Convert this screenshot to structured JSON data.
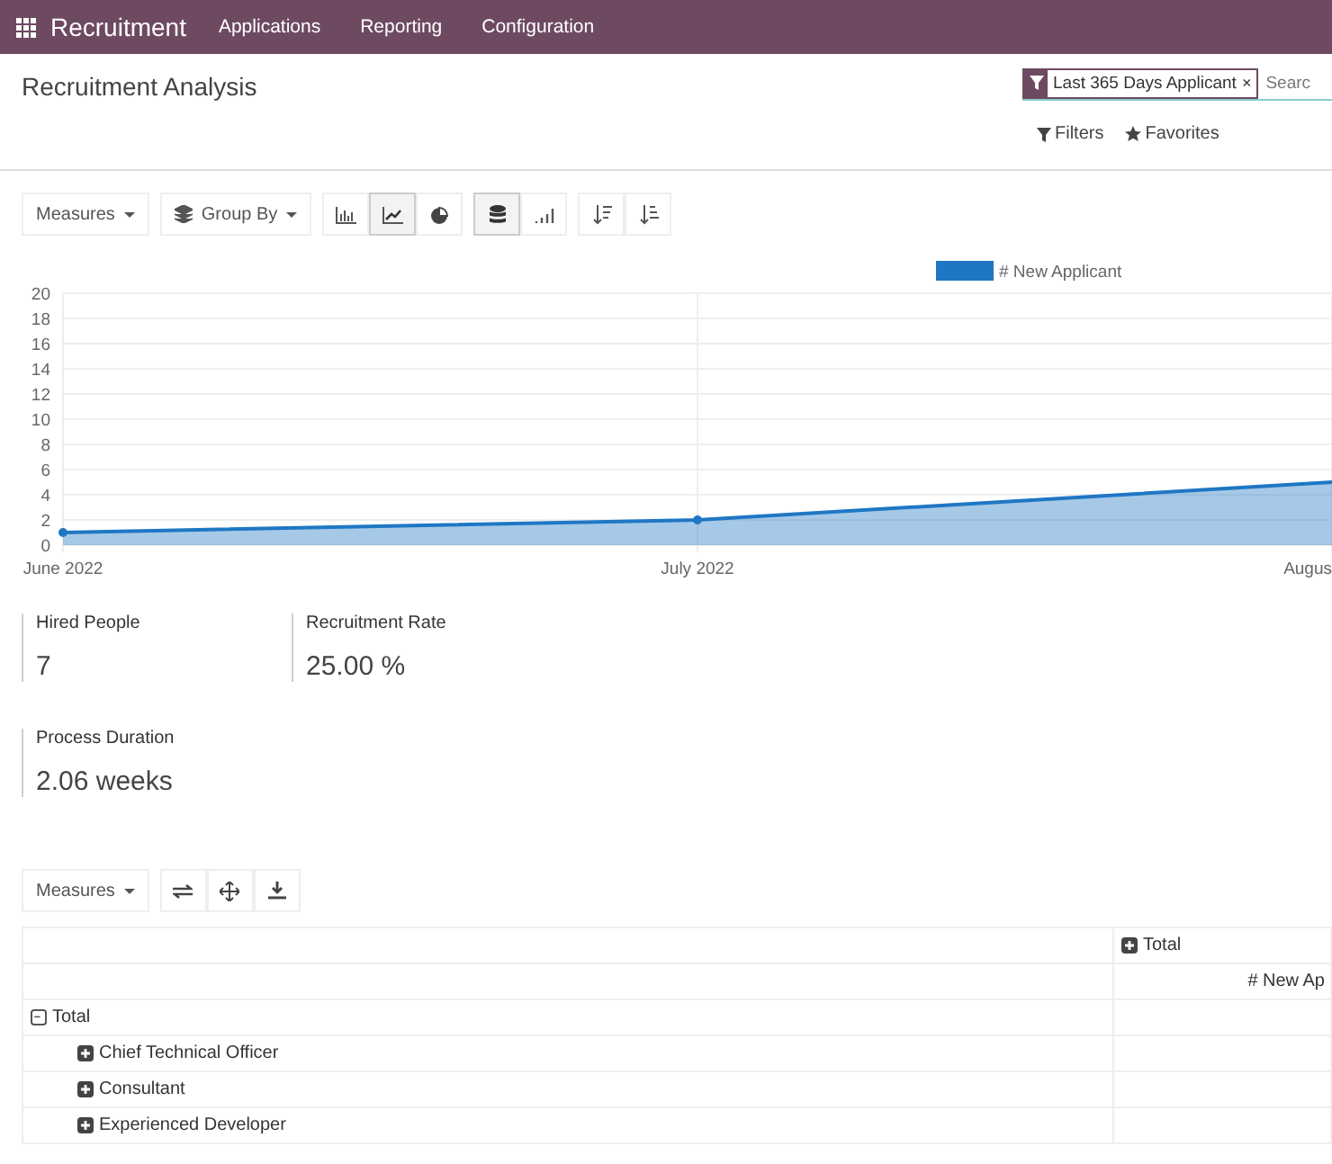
{
  "navbar": {
    "app_name": "Recruitment",
    "menu": [
      "Applications",
      "Reporting",
      "Configuration"
    ]
  },
  "control_panel": {
    "title": "Recruitment Analysis",
    "search": {
      "facets": [
        {
          "label": "Last 365 Days Applicant",
          "remove": "×"
        }
      ],
      "placeholder": "Searc"
    },
    "buttons": [
      {
        "label": "Filters",
        "kind": "filter"
      },
      {
        "label": "Favorites",
        "kind": "star"
      }
    ]
  },
  "graph_toolbar": {
    "measures": "Measures",
    "group_by": "Group By",
    "chart_types": [
      {
        "kind": "bar",
        "selected": false
      },
      {
        "kind": "line",
        "selected": true
      },
      {
        "kind": "pie",
        "selected": false
      }
    ],
    "stacked": true
  },
  "chart": {
    "chart_data": {
      "type": "area",
      "categories": [
        "June 2022",
        "July 2022",
        "Augus"
      ],
      "series": [
        {
          "name": "# New Applicant",
          "color": "#1f77c4",
          "values": [
            1,
            2,
            5
          ]
        }
      ],
      "ylim": [
        0,
        20
      ],
      "yticks": [
        0,
        2,
        4,
        6,
        8,
        10,
        12,
        14,
        16,
        18,
        20
      ],
      "grid": true
    }
  },
  "kpis": [
    {
      "label": "Hired People",
      "value": "7"
    },
    {
      "label": "Recruitment Rate",
      "value": "25.00 %"
    },
    {
      "label": "Process Duration",
      "value": "2.06 weeks"
    }
  ],
  "pivot": {
    "measures": "Measures",
    "column_header": {
      "label": "Total",
      "expanded": false
    },
    "measure_header": "# New Ap",
    "rows": [
      {
        "label": "Total",
        "expanded": true,
        "children": [
          {
            "label": "Chief Technical Officer",
            "expanded": false
          },
          {
            "label": "Consultant",
            "expanded": false
          },
          {
            "label": "Experienced Developer",
            "expanded": false
          }
        ]
      }
    ]
  }
}
